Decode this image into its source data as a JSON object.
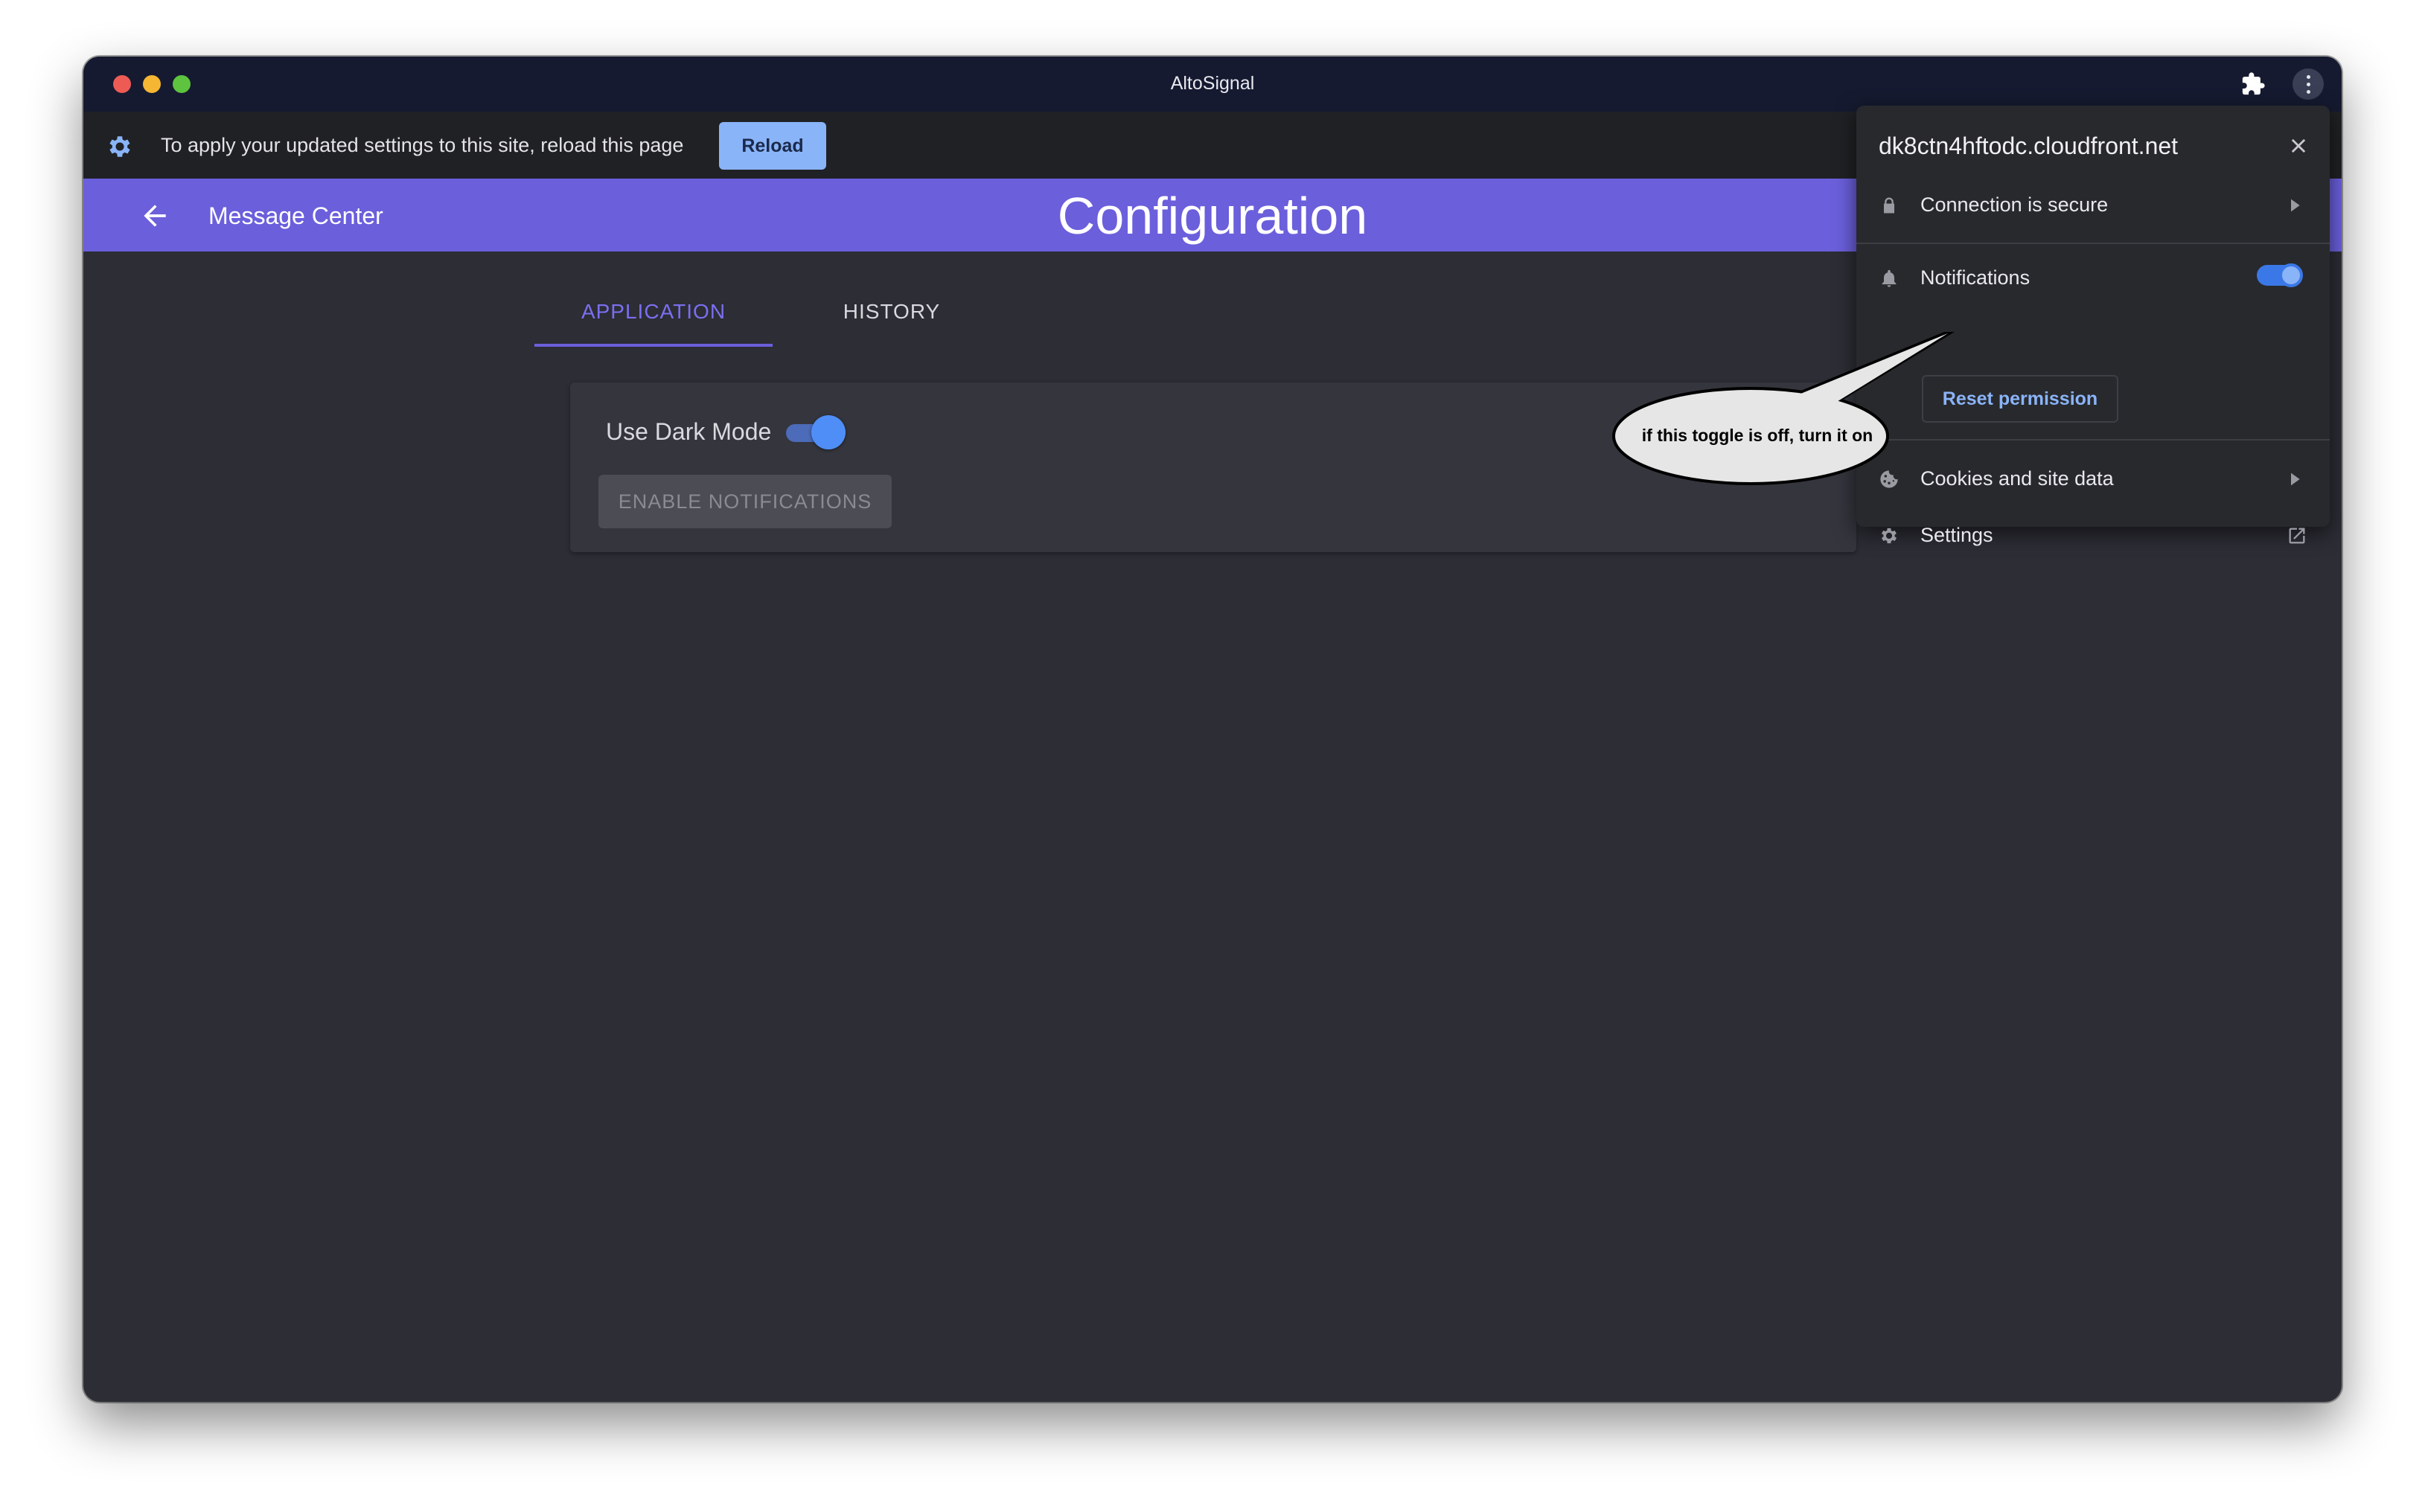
{
  "window": {
    "title": "AltoSignal"
  },
  "infobar": {
    "message": "To apply your updated settings to this site, reload this page",
    "reload_label": "Reload"
  },
  "appbar": {
    "back_label": "Message Center",
    "title": "Configuration"
  },
  "tabs": [
    {
      "label": "APPLICATION",
      "active": true
    },
    {
      "label": "HISTORY",
      "active": false
    }
  ],
  "card": {
    "dark_mode_label": "Use Dark Mode",
    "dark_mode_on": true,
    "enable_notifications_label": "ENABLE NOTIFICATIONS"
  },
  "site_popup": {
    "domain": "dk8ctn4hftodc.cloudfront.net",
    "connection_label": "Connection is secure",
    "notifications_label": "Notifications",
    "notifications_on": true,
    "reset_label": "Reset permission",
    "cookies_label": "Cookies and site data",
    "settings_label": "Settings"
  },
  "annotation": {
    "text": "if this toggle is off, turn it on"
  },
  "colors": {
    "titlebar": "#151a30",
    "appbar": "#6b5fdc",
    "content_bg": "#2c2d35",
    "toggle_blue": "#4f8ef7",
    "link_blue": "#8ab4f8"
  }
}
